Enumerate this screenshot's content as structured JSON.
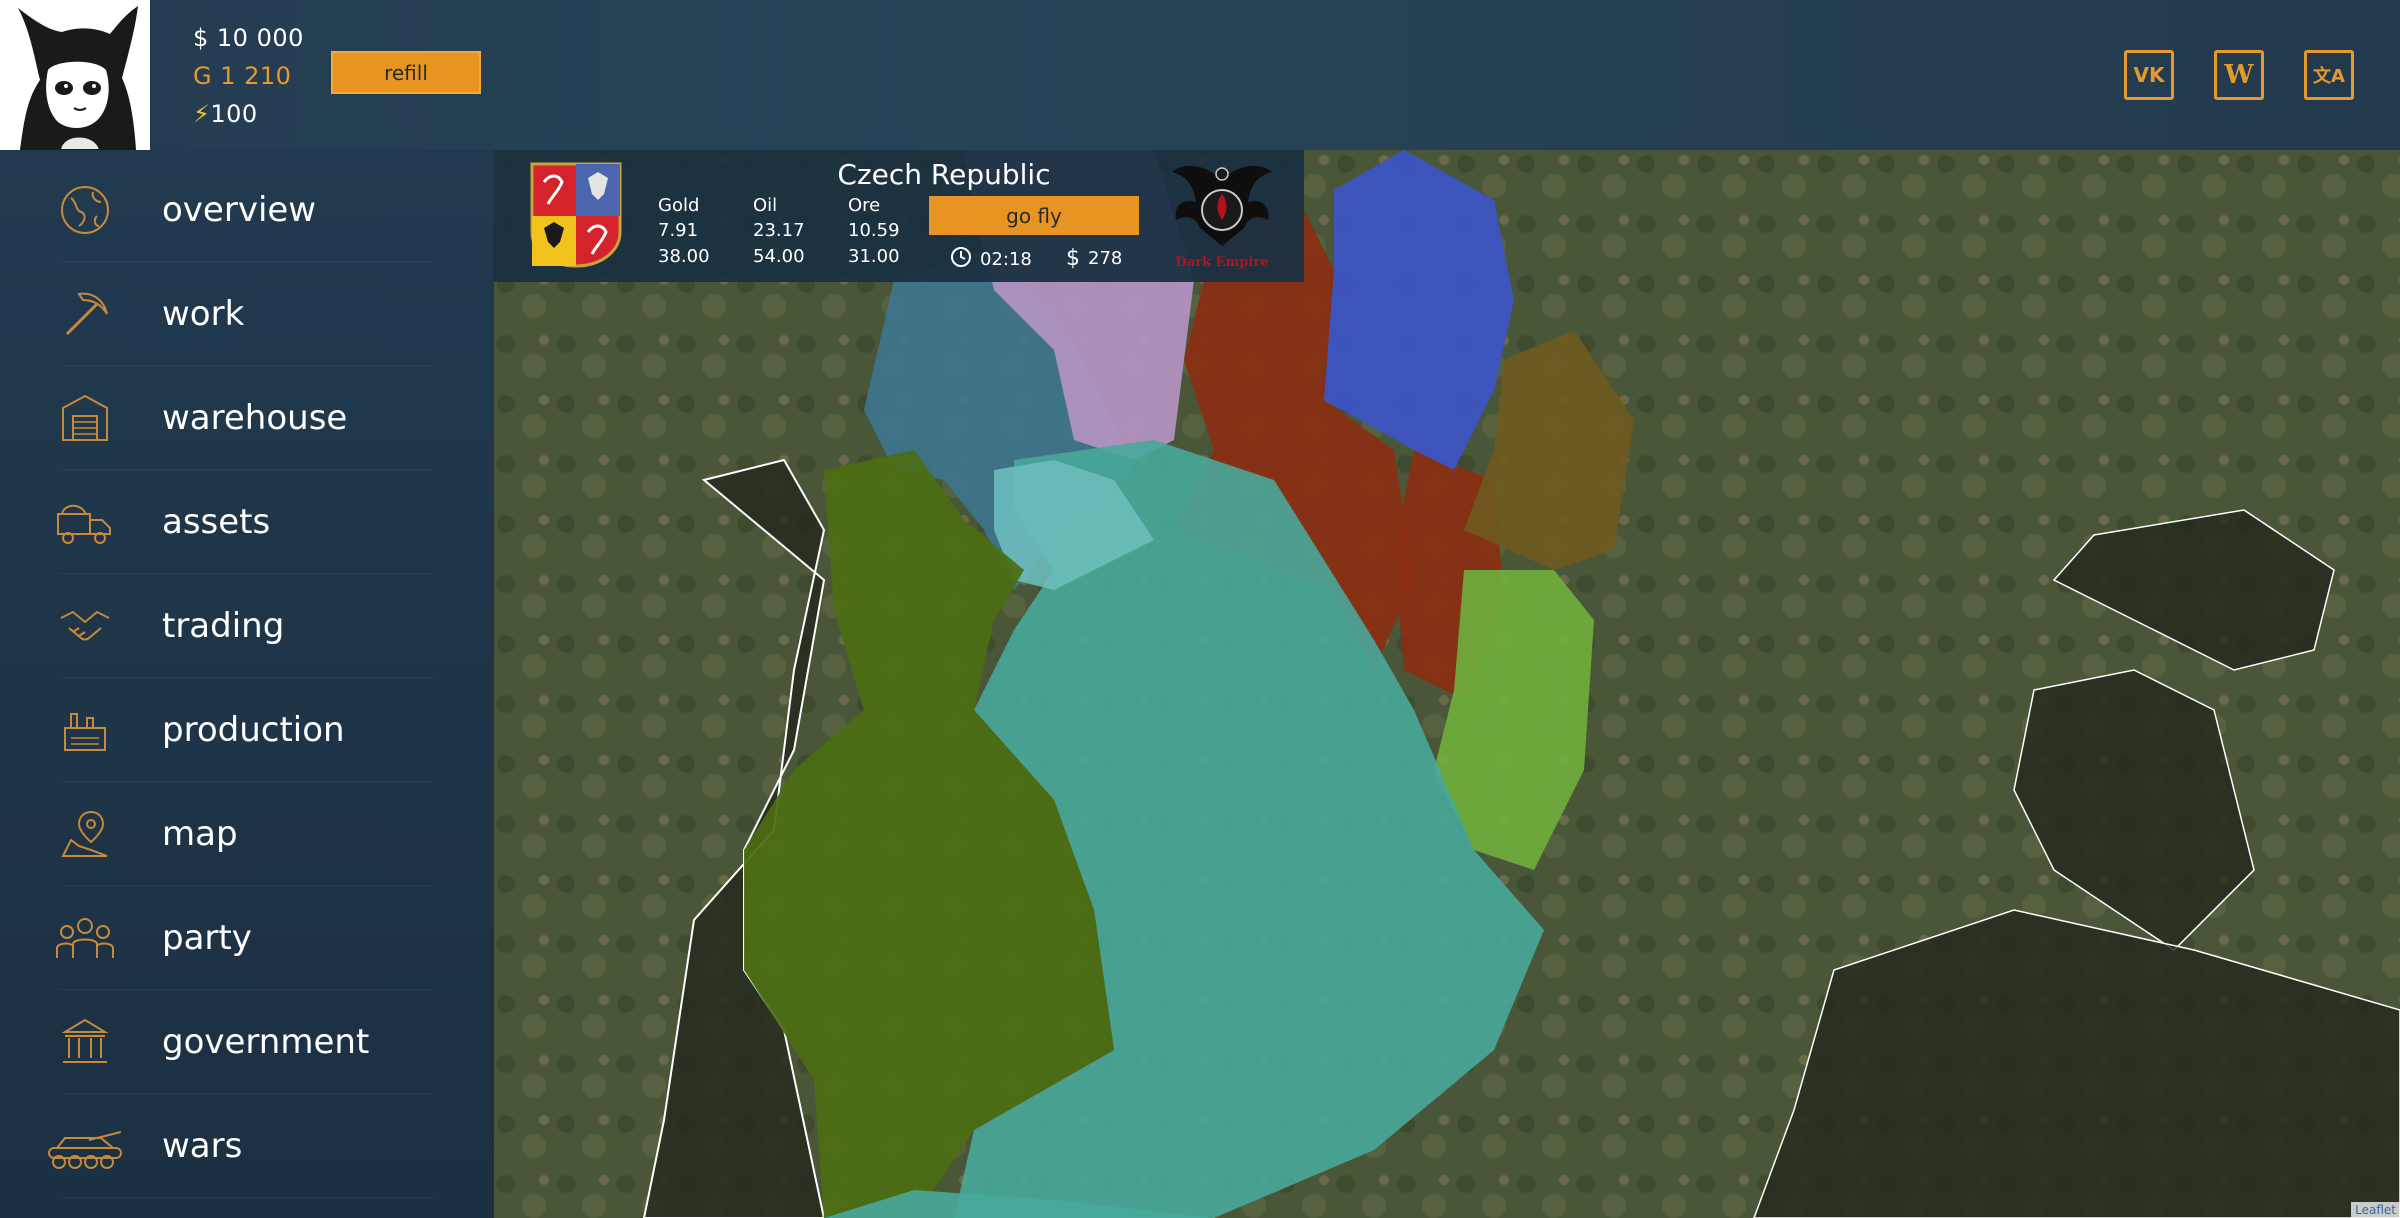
{
  "header": {
    "money": "$ 10 000",
    "gold": "G 1 210",
    "energy": "100",
    "refill_label": "refill",
    "social": [
      {
        "name": "vk-icon",
        "glyph": "VK"
      },
      {
        "name": "wiki-icon",
        "glyph": "W"
      },
      {
        "name": "translate-icon",
        "glyph": "文A"
      }
    ]
  },
  "sidebar": {
    "items": [
      {
        "label": "overview",
        "icon": "globe-icon"
      },
      {
        "label": "work",
        "icon": "pickaxe-icon"
      },
      {
        "label": "warehouse",
        "icon": "warehouse-icon"
      },
      {
        "label": "assets",
        "icon": "truck-icon"
      },
      {
        "label": "trading",
        "icon": "handshake-icon"
      },
      {
        "label": "production",
        "icon": "factory-icon"
      },
      {
        "label": "map",
        "icon": "map-pin-icon"
      },
      {
        "label": "party",
        "icon": "people-icon"
      },
      {
        "label": "government",
        "icon": "capitol-icon"
      },
      {
        "label": "wars",
        "icon": "tank-icon"
      }
    ]
  },
  "region": {
    "name": "Czech Republic",
    "resources": [
      {
        "label": "Gold",
        "current": "7.91",
        "max": "38.00"
      },
      {
        "label": "Oil",
        "current": "23.17",
        "max": "54.00"
      },
      {
        "label": "Ore",
        "current": "10.59",
        "max": "31.00"
      }
    ],
    "go_fly_label": "go fly",
    "time": "02:18",
    "cost_symbol": "$",
    "cost": "278",
    "emblem_text": "Dark Empire"
  },
  "map": {
    "attribution": "Leaflet"
  },
  "colors": {
    "accent": "#e89422",
    "panel": "#1b3042",
    "sidebar": "#1e3447"
  }
}
